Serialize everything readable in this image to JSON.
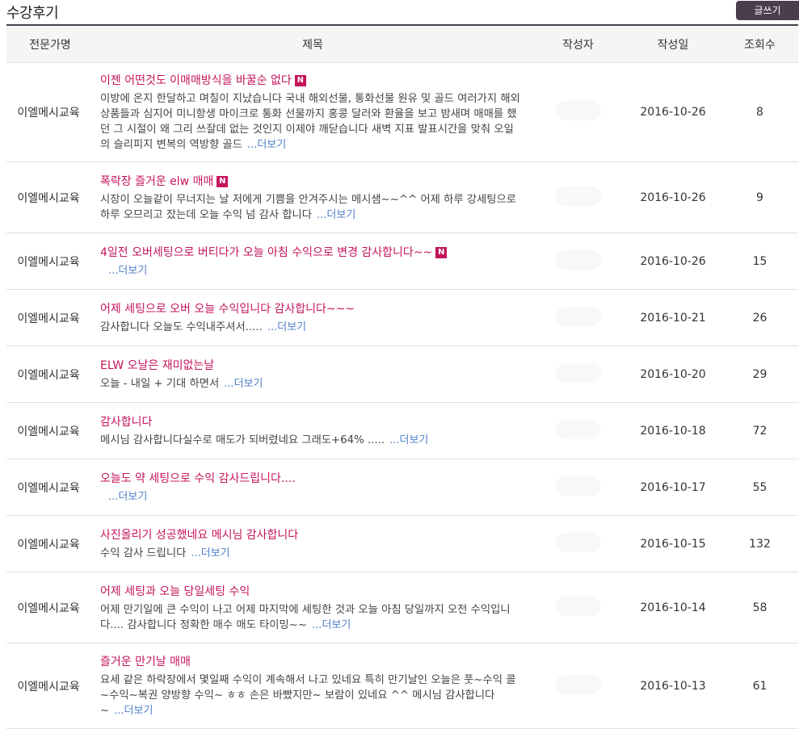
{
  "header": {
    "title": "수강후기",
    "write_button": "글쓰기"
  },
  "table": {
    "columns": [
      "전문가명",
      "제목",
      "작성자",
      "작성일",
      "조회수"
    ],
    "rows": [
      {
        "expert": "이엘메시교육",
        "title": "이젠 어떤것도 이매매방식을 바꿀순 없다",
        "is_new": true,
        "excerpt": "이방에 온지 한달하고 며칠이 지났습니다 국내 해외선물, 통화선물 원유 및 골드 여러가지 해외상품들과 심지어 미니항생 마이크로 통화 선물까지 홍콩 달러와 환율을 보고 밤새며 매매를 했던 그 시절이 왜 그리 쓰잘데 없는 것인지 이제야 깨닫습니다 새벽 지표 발표시간을 맞춰 오일의 슬리피지 변복의 역방향 골드",
        "more": "...더보기",
        "date": "2016-10-26",
        "views": "8"
      },
      {
        "expert": "이엘메시교육",
        "title": "폭락장 즐거운 elw 매매",
        "is_new": true,
        "excerpt": "시장이 오늘같이 무너지는 날 저에게 기쁨을 안겨주시는 메시샘~~^^ 어제 하루 강세팅으로 하루 오므리고 잤는데 오늘 수익 넘 감사 합니다",
        "more": "...더보기",
        "date": "2016-10-26",
        "views": "9"
      },
      {
        "expert": "이엘메시교육",
        "title": "4일전 오버세팅으로 버티다가 오늘 아침 수익으로 변경 감사합니다~~",
        "is_new": true,
        "excerpt": "",
        "more": "...더보기",
        "date": "2016-10-26",
        "views": "15"
      },
      {
        "expert": "이엘메시교육",
        "title": "어제 세팅으로 오버 오늘 수익입니다 감사합니다~~~",
        "is_new": false,
        "excerpt": "감사합니다 오늘도 수익내주셔서.....",
        "more": "...더보기",
        "date": "2016-10-21",
        "views": "26"
      },
      {
        "expert": "이엘메시교육",
        "title": "ELW 오날은 재미없는날",
        "is_new": false,
        "excerpt": "오늘 - 내일 + 기대 하면서",
        "more": "...더보기",
        "date": "2016-10-20",
        "views": "29"
      },
      {
        "expert": "이엘메시교육",
        "title": "감사합니다",
        "is_new": false,
        "excerpt": "메시님 감사합니다실수로 매도가 되버렸네요 그래도+64% .....",
        "more": "...더보기",
        "date": "2016-10-18",
        "views": "72"
      },
      {
        "expert": "이엘메시교육",
        "title": "오늘도 약 세팅으로 수익 감사드립니다....",
        "is_new": false,
        "excerpt": "",
        "more": "...더보기",
        "date": "2016-10-17",
        "views": "55"
      },
      {
        "expert": "이엘메시교육",
        "title": "사진올리기 성공했네요 메시님 감사합니다",
        "is_new": false,
        "excerpt": "수익 감사 드립니다",
        "more": "...더보기",
        "date": "2016-10-15",
        "views": "132"
      },
      {
        "expert": "이엘메시교육",
        "title": "어제 세팅과 오늘 당일세팅 수익",
        "is_new": false,
        "excerpt": "어제 만기일에 큰 수익이 나고 어제 마지막에 세팅한 것과 오늘 아침 당일까지 오전 수익입니다.... 감사합니다 정확한 매수 매도 타이밍~~",
        "more": "...더보기",
        "date": "2016-10-14",
        "views": "58"
      },
      {
        "expert": "이엘메시교육",
        "title": "즐거운 만기날 매매",
        "is_new": false,
        "excerpt": "요세 같은 하락장에서 몇일째 수익이 계속해서 나고 있네요 특히 만기날인 오늘은 풋~수익 콜~수익~복권 양방향 수익~ ㅎㅎ 손은 바빴지만~ 보람이 있네요 ^^ 메시님 감사합니다~",
        "more": "...더보기",
        "date": "2016-10-13",
        "views": "61"
      }
    ],
    "new_badge": "N"
  },
  "colors": {
    "accent": "#c4155b",
    "header_border": "#4a3e4c",
    "link": "#4f80c9"
  }
}
